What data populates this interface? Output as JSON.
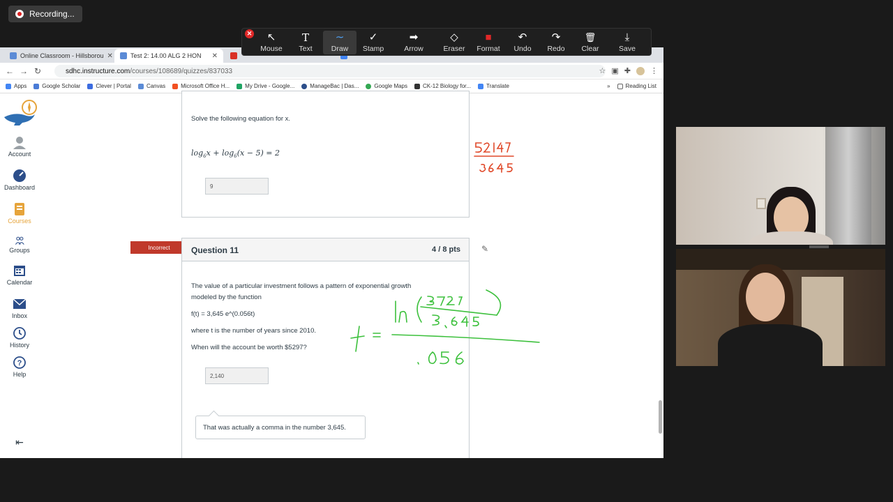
{
  "recording": {
    "label": "Recording..."
  },
  "toolbar": {
    "tools": [
      {
        "label": "Mouse",
        "icon": "↖"
      },
      {
        "label": "Text",
        "icon": "T"
      },
      {
        "label": "Draw",
        "icon": "∼"
      },
      {
        "label": "Stamp",
        "icon": "✓"
      },
      {
        "label": "Arrow",
        "icon": "➡"
      },
      {
        "label": "Eraser",
        "icon": "◇"
      },
      {
        "label": "Format",
        "icon": "■"
      },
      {
        "label": "Undo",
        "icon": "↶"
      },
      {
        "label": "Redo",
        "icon": "↷"
      },
      {
        "label": "Clear",
        "icon": "🗑"
      },
      {
        "label": "Save",
        "icon": "⤓"
      }
    ],
    "active_tool": "Draw",
    "format_color": "#e02828"
  },
  "browser": {
    "tabs": [
      {
        "title": "Online Classroom - Hillsborou",
        "close": "✕"
      },
      {
        "title": "Test 2: 14.00 ALG 2 HON",
        "close": "✕"
      }
    ],
    "url_host": "sdhc.instructure.com",
    "url_path": "/courses/108689/quizzes/837033",
    "bookmarks": [
      "Apps",
      "Google Scholar",
      "Clever | Portal",
      "Canvas",
      "Microsoft Office H...",
      "My Drive - Google...",
      "ManageBac | Das...",
      "Google Maps",
      "CK-12 Biology for...",
      "Translate"
    ],
    "bookmarks_more": "»",
    "reading_list": "Reading List"
  },
  "global_nav": [
    {
      "label": "Account"
    },
    {
      "label": "Dashboard"
    },
    {
      "label": "Courses"
    },
    {
      "label": "Groups"
    },
    {
      "label": "Calendar"
    },
    {
      "label": "Inbox"
    },
    {
      "label": "History"
    },
    {
      "label": "Help"
    }
  ],
  "question10": {
    "prompt": "Solve the following equation for x.",
    "answer": "9"
  },
  "question11": {
    "badge": "Incorrect",
    "title": "Question 11",
    "points": "4 / 8 pts",
    "text_line1": "The value of a particular investment follows a pattern of exponential growth",
    "text_line2": "modeled by the function",
    "function": "f(t) = 3,645 e^(0.056t)",
    "text_line3": " where t is the number of years since 2010.",
    "text_line4": "When will the account be worth $5297?",
    "answer": "2,140",
    "comment": "That was actually a comma in the number 3,645."
  },
  "colors": {
    "canvas_accent": "#e6a43b",
    "incorrect_red": "#c0392b",
    "ink_red": "#e0492a",
    "ink_green": "#3cc03c"
  }
}
